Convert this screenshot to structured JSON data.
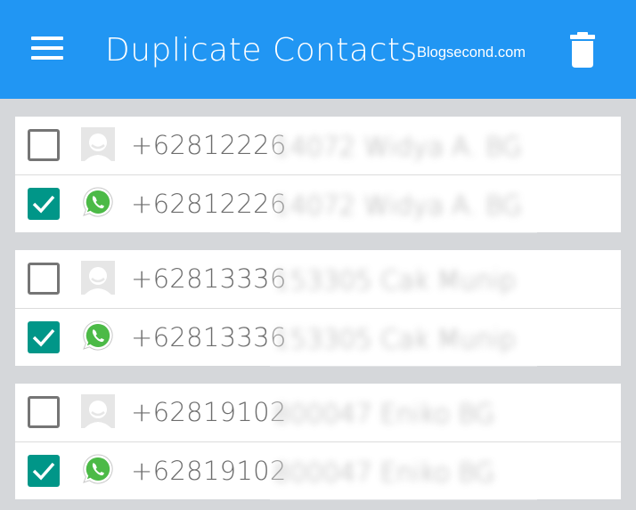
{
  "appbar": {
    "title": "Duplicate Contacts",
    "site": "Blogsecond.com",
    "menu_icon": "hamburger-menu-icon",
    "delete_icon": "trash-icon",
    "color": "#2196f3"
  },
  "groups": [
    {
      "rows": [
        {
          "checked": false,
          "icon": "contact-avatar-icon",
          "number": "+62812226",
          "rest": "14072 Widya A. BG"
        },
        {
          "checked": true,
          "icon": "whatsapp-icon",
          "number": "+62812226",
          "rest": "14072 Widya A. BG"
        }
      ]
    },
    {
      "rows": [
        {
          "checked": false,
          "icon": "contact-avatar-icon",
          "number": "+62813336",
          "rest": "153305 Cak Munip"
        },
        {
          "checked": true,
          "icon": "whatsapp-icon",
          "number": "+62813336",
          "rest": "153305 Cak Munip"
        }
      ]
    },
    {
      "rows": [
        {
          "checked": false,
          "icon": "contact-avatar-icon",
          "number": "+62819102",
          "rest": "800047 Eniko BG"
        },
        {
          "checked": true,
          "icon": "whatsapp-icon",
          "number": "+62819102",
          "rest": "800047 Eniko BG"
        }
      ]
    }
  ],
  "colors": {
    "checkbox_checked": "#009688",
    "whatsapp": "#4cba47"
  }
}
